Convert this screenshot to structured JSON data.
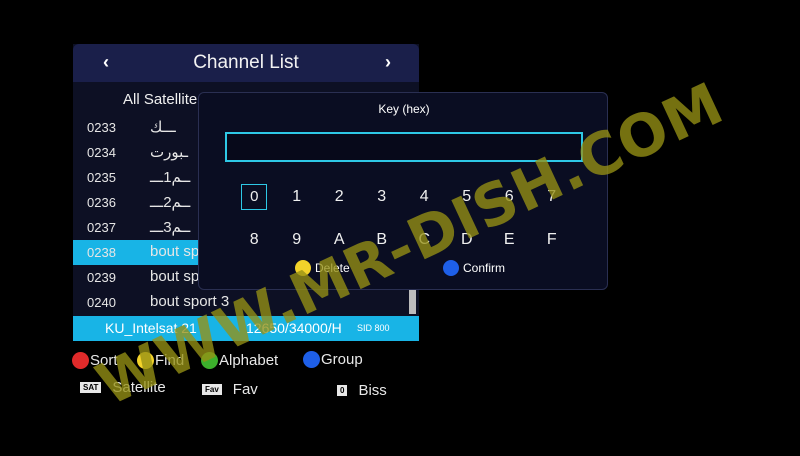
{
  "channel_list": {
    "title": "Channel List",
    "prev_icon": "‹",
    "next_icon": "›",
    "satellite_title": "All Satellite",
    "channels": [
      {
        "number": "0233",
        "name": "ـــك"
      },
      {
        "number": "0234",
        "name": "ـبورت"
      },
      {
        "number": "0235",
        "name": "ــم1ـــ"
      },
      {
        "number": "0236",
        "name": "ــم2ـــ"
      },
      {
        "number": "0237",
        "name": "ــم3ـــ"
      },
      {
        "number": "0238",
        "name": "bout sp",
        "selected": true
      },
      {
        "number": "0239",
        "name": "bout sp"
      },
      {
        "number": "0240",
        "name": "bout sport 3"
      }
    ],
    "info": {
      "satellite": "KU_Intelsat 21",
      "transponder": "12650/34000/H",
      "sid": "SID 800"
    }
  },
  "key_dialog": {
    "title": "Key (hex)",
    "input_value": "",
    "keys": [
      "0",
      "1",
      "2",
      "3",
      "4",
      "5",
      "6",
      "7",
      "8",
      "9",
      "A",
      "B",
      "C",
      "D",
      "E",
      "F"
    ],
    "focused_key": "0",
    "delete_label": "Delete",
    "confirm_label": "Confirm",
    "delete_color": "#f2d22a",
    "confirm_color": "#1e5fe8"
  },
  "legend": {
    "sort_label": "Sort",
    "find_label": "Find",
    "alphabet_label": "Alphabet",
    "group_label": "Group",
    "satellite_badge": "SAT",
    "satellite_label": "Satellite",
    "fav_badge": "Fav",
    "fav_label": "Fav",
    "biss_badge": "0",
    "biss_label": "Biss",
    "colors": {
      "red": "#e02a2a",
      "yellow": "#f2d22a",
      "green": "#3cb02c",
      "blue": "#1e5fe8"
    }
  },
  "watermark": "WWW.MR-DISH.COM"
}
